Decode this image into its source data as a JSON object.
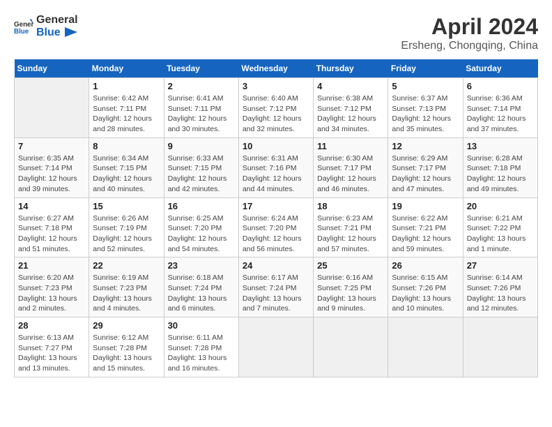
{
  "header": {
    "logo_general": "General",
    "logo_blue": "Blue",
    "title": "April 2024",
    "subtitle": "Ersheng, Chongqing, China"
  },
  "columns": [
    "Sunday",
    "Monday",
    "Tuesday",
    "Wednesday",
    "Thursday",
    "Friday",
    "Saturday"
  ],
  "weeks": [
    [
      {
        "day": "",
        "detail": ""
      },
      {
        "day": "1",
        "detail": "Sunrise: 6:42 AM\nSunset: 7:11 PM\nDaylight: 12 hours\nand 28 minutes."
      },
      {
        "day": "2",
        "detail": "Sunrise: 6:41 AM\nSunset: 7:11 PM\nDaylight: 12 hours\nand 30 minutes."
      },
      {
        "day": "3",
        "detail": "Sunrise: 6:40 AM\nSunset: 7:12 PM\nDaylight: 12 hours\nand 32 minutes."
      },
      {
        "day": "4",
        "detail": "Sunrise: 6:38 AM\nSunset: 7:12 PM\nDaylight: 12 hours\nand 34 minutes."
      },
      {
        "day": "5",
        "detail": "Sunrise: 6:37 AM\nSunset: 7:13 PM\nDaylight: 12 hours\nand 35 minutes."
      },
      {
        "day": "6",
        "detail": "Sunrise: 6:36 AM\nSunset: 7:14 PM\nDaylight: 12 hours\nand 37 minutes."
      }
    ],
    [
      {
        "day": "7",
        "detail": "Sunrise: 6:35 AM\nSunset: 7:14 PM\nDaylight: 12 hours\nand 39 minutes."
      },
      {
        "day": "8",
        "detail": "Sunrise: 6:34 AM\nSunset: 7:15 PM\nDaylight: 12 hours\nand 40 minutes."
      },
      {
        "day": "9",
        "detail": "Sunrise: 6:33 AM\nSunset: 7:15 PM\nDaylight: 12 hours\nand 42 minutes."
      },
      {
        "day": "10",
        "detail": "Sunrise: 6:31 AM\nSunset: 7:16 PM\nDaylight: 12 hours\nand 44 minutes."
      },
      {
        "day": "11",
        "detail": "Sunrise: 6:30 AM\nSunset: 7:17 PM\nDaylight: 12 hours\nand 46 minutes."
      },
      {
        "day": "12",
        "detail": "Sunrise: 6:29 AM\nSunset: 7:17 PM\nDaylight: 12 hours\nand 47 minutes."
      },
      {
        "day": "13",
        "detail": "Sunrise: 6:28 AM\nSunset: 7:18 PM\nDaylight: 12 hours\nand 49 minutes."
      }
    ],
    [
      {
        "day": "14",
        "detail": "Sunrise: 6:27 AM\nSunset: 7:18 PM\nDaylight: 12 hours\nand 51 minutes."
      },
      {
        "day": "15",
        "detail": "Sunrise: 6:26 AM\nSunset: 7:19 PM\nDaylight: 12 hours\nand 52 minutes."
      },
      {
        "day": "16",
        "detail": "Sunrise: 6:25 AM\nSunset: 7:20 PM\nDaylight: 12 hours\nand 54 minutes."
      },
      {
        "day": "17",
        "detail": "Sunrise: 6:24 AM\nSunset: 7:20 PM\nDaylight: 12 hours\nand 56 minutes."
      },
      {
        "day": "18",
        "detail": "Sunrise: 6:23 AM\nSunset: 7:21 PM\nDaylight: 12 hours\nand 57 minutes."
      },
      {
        "day": "19",
        "detail": "Sunrise: 6:22 AM\nSunset: 7:21 PM\nDaylight: 12 hours\nand 59 minutes."
      },
      {
        "day": "20",
        "detail": "Sunrise: 6:21 AM\nSunset: 7:22 PM\nDaylight: 13 hours\nand 1 minute."
      }
    ],
    [
      {
        "day": "21",
        "detail": "Sunrise: 6:20 AM\nSunset: 7:23 PM\nDaylight: 13 hours\nand 2 minutes."
      },
      {
        "day": "22",
        "detail": "Sunrise: 6:19 AM\nSunset: 7:23 PM\nDaylight: 13 hours\nand 4 minutes."
      },
      {
        "day": "23",
        "detail": "Sunrise: 6:18 AM\nSunset: 7:24 PM\nDaylight: 13 hours\nand 6 minutes."
      },
      {
        "day": "24",
        "detail": "Sunrise: 6:17 AM\nSunset: 7:24 PM\nDaylight: 13 hours\nand 7 minutes."
      },
      {
        "day": "25",
        "detail": "Sunrise: 6:16 AM\nSunset: 7:25 PM\nDaylight: 13 hours\nand 9 minutes."
      },
      {
        "day": "26",
        "detail": "Sunrise: 6:15 AM\nSunset: 7:26 PM\nDaylight: 13 hours\nand 10 minutes."
      },
      {
        "day": "27",
        "detail": "Sunrise: 6:14 AM\nSunset: 7:26 PM\nDaylight: 13 hours\nand 12 minutes."
      }
    ],
    [
      {
        "day": "28",
        "detail": "Sunrise: 6:13 AM\nSunset: 7:27 PM\nDaylight: 13 hours\nand 13 minutes."
      },
      {
        "day": "29",
        "detail": "Sunrise: 6:12 AM\nSunset: 7:28 PM\nDaylight: 13 hours\nand 15 minutes."
      },
      {
        "day": "30",
        "detail": "Sunrise: 6:11 AM\nSunset: 7:28 PM\nDaylight: 13 hours\nand 16 minutes."
      },
      {
        "day": "",
        "detail": ""
      },
      {
        "day": "",
        "detail": ""
      },
      {
        "day": "",
        "detail": ""
      },
      {
        "day": "",
        "detail": ""
      }
    ]
  ]
}
